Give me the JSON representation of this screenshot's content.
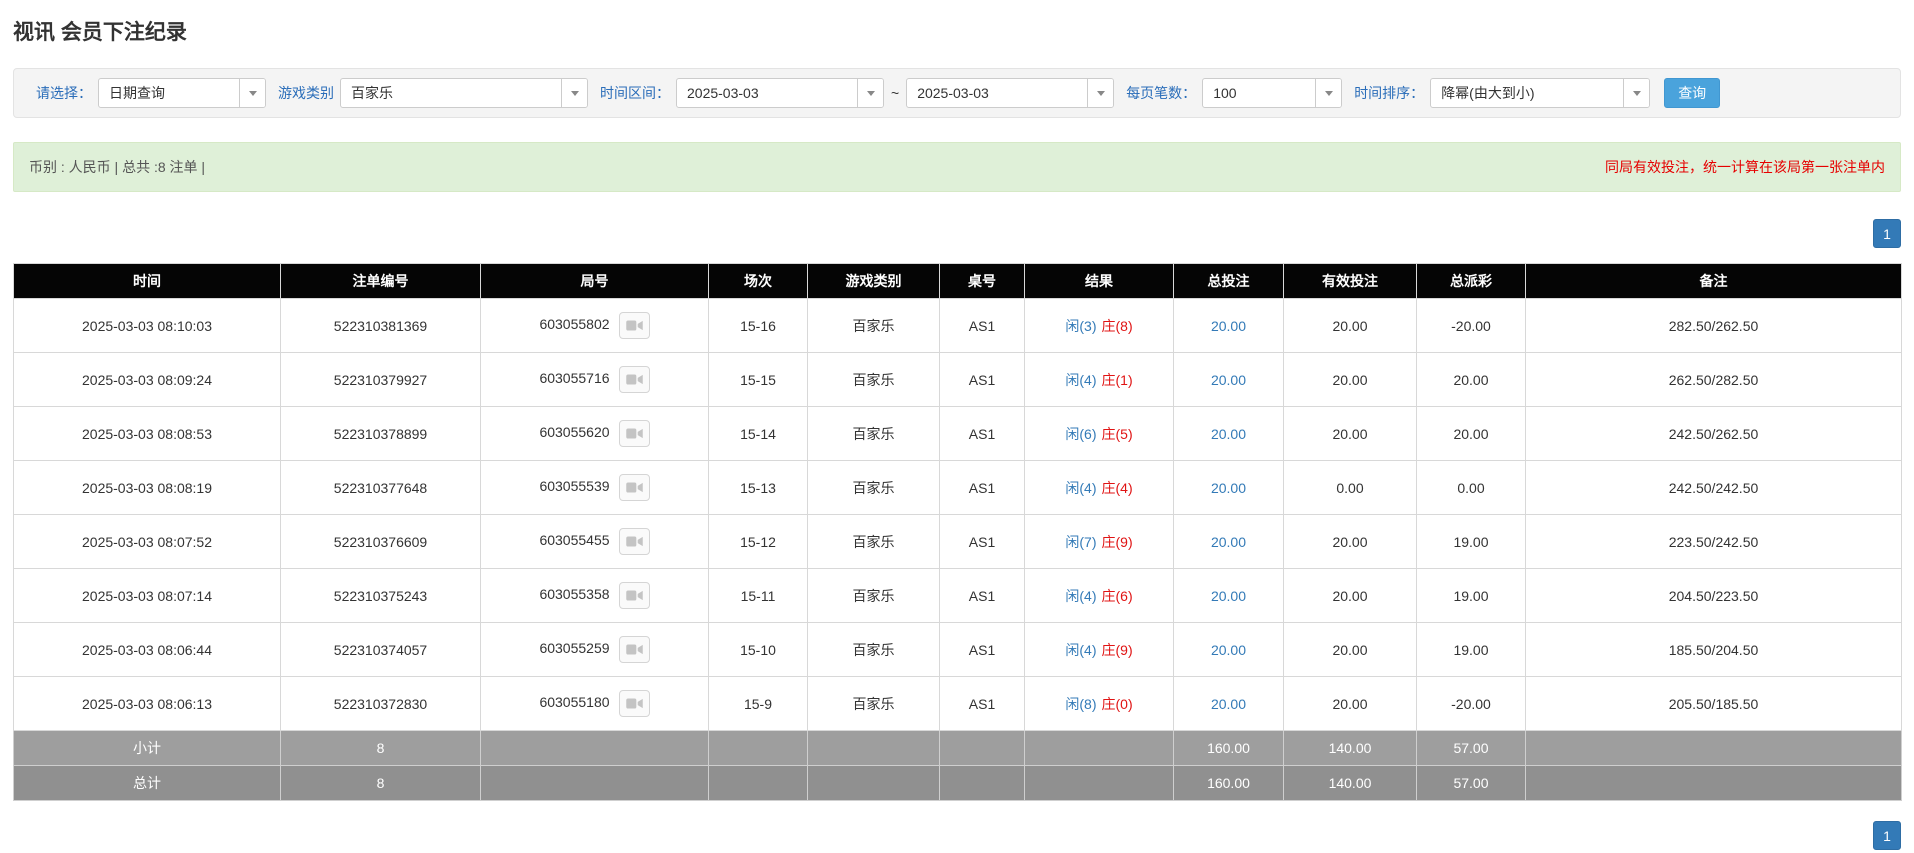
{
  "title": "视讯 会员下注纪录",
  "filters": {
    "select_label": "请选择：",
    "select_value": "日期查询",
    "game_label": "游戏类别",
    "game_value": "百家乐",
    "range_label": "时间区间：",
    "date_from": "2025-03-03",
    "range_sep": "~",
    "date_to": "2025-03-03",
    "page_size_label": "每页笔数：",
    "page_size_value": "100",
    "sort_label": "时间排序：",
    "sort_value": "降幂(由大到小)",
    "search_button": "查询"
  },
  "info_bar": {
    "summary": "币别 : 人民币 | 总共 :8 注单 |",
    "note": "同局有效投注，统一计算在该局第一张注单内"
  },
  "pagination": {
    "page": "1"
  },
  "icons": {
    "combo_caret": "caret-down",
    "round_media": "video-camera"
  },
  "colors": {
    "accent_blue": "#337ab7",
    "label_blue": "#2a6db9",
    "negative_red": "#e01414",
    "notice_red": "#e60000",
    "success_bg": "#dff0d8",
    "header_bg": "#050505",
    "footer_gray": "#9e9e9e",
    "search_button_blue": "#4aa3dc"
  },
  "table": {
    "headers": [
      "时间",
      "注单编号",
      "局号",
      "场次",
      "游戏类别",
      "桌号",
      "结果",
      "总投注",
      "有效投注",
      "总派彩",
      "备注"
    ],
    "rows": [
      {
        "time": "2025-03-03 08:10:03",
        "bet_id": "522310381369",
        "round_id": "603055802",
        "session": "15-16",
        "game": "百家乐",
        "table_no": "AS1",
        "result_player": "闲(3)",
        "result_banker": "庄(8)",
        "total_bet": "20.00",
        "valid_bet": "20.00",
        "payout": "-20.00",
        "remark": "282.50/262.50"
      },
      {
        "time": "2025-03-03 08:09:24",
        "bet_id": "522310379927",
        "round_id": "603055716",
        "session": "15-15",
        "game": "百家乐",
        "table_no": "AS1",
        "result_player": "闲(4)",
        "result_banker": "庄(1)",
        "total_bet": "20.00",
        "valid_bet": "20.00",
        "payout": "20.00",
        "remark": "262.50/282.50"
      },
      {
        "time": "2025-03-03 08:08:53",
        "bet_id": "522310378899",
        "round_id": "603055620",
        "session": "15-14",
        "game": "百家乐",
        "table_no": "AS1",
        "result_player": "闲(6)",
        "result_banker": "庄(5)",
        "total_bet": "20.00",
        "valid_bet": "20.00",
        "payout": "20.00",
        "remark": "242.50/262.50"
      },
      {
        "time": "2025-03-03 08:08:19",
        "bet_id": "522310377648",
        "round_id": "603055539",
        "session": "15-13",
        "game": "百家乐",
        "table_no": "AS1",
        "result_player": "闲(4)",
        "result_banker": "庄(4)",
        "total_bet": "20.00",
        "valid_bet": "0.00",
        "payout": "0.00",
        "remark": "242.50/242.50"
      },
      {
        "time": "2025-03-03 08:07:52",
        "bet_id": "522310376609",
        "round_id": "603055455",
        "session": "15-12",
        "game": "百家乐",
        "table_no": "AS1",
        "result_player": "闲(7)",
        "result_banker": "庄(9)",
        "total_bet": "20.00",
        "valid_bet": "20.00",
        "payout": "19.00",
        "remark": "223.50/242.50"
      },
      {
        "time": "2025-03-03 08:07:14",
        "bet_id": "522310375243",
        "round_id": "603055358",
        "session": "15-11",
        "game": "百家乐",
        "table_no": "AS1",
        "result_player": "闲(4)",
        "result_banker": "庄(6)",
        "total_bet": "20.00",
        "valid_bet": "20.00",
        "payout": "19.00",
        "remark": "204.50/223.50"
      },
      {
        "time": "2025-03-03 08:06:44",
        "bet_id": "522310374057",
        "round_id": "603055259",
        "session": "15-10",
        "game": "百家乐",
        "table_no": "AS1",
        "result_player": "闲(4)",
        "result_banker": "庄(9)",
        "total_bet": "20.00",
        "valid_bet": "20.00",
        "payout": "19.00",
        "remark": "185.50/204.50"
      },
      {
        "time": "2025-03-03 08:06:13",
        "bet_id": "522310372830",
        "round_id": "603055180",
        "session": "15-9",
        "game": "百家乐",
        "table_no": "AS1",
        "result_player": "闲(8)",
        "result_banker": "庄(0)",
        "total_bet": "20.00",
        "valid_bet": "20.00",
        "payout": "-20.00",
        "remark": "205.50/185.50"
      }
    ],
    "subtotal": {
      "label": "小计",
      "count": "8",
      "total_bet": "160.00",
      "valid_bet": "140.00",
      "payout": "57.00"
    },
    "grand_total": {
      "label": "总计",
      "count": "8",
      "total_bet": "160.00",
      "valid_bet": "140.00",
      "payout": "57.00"
    }
  }
}
